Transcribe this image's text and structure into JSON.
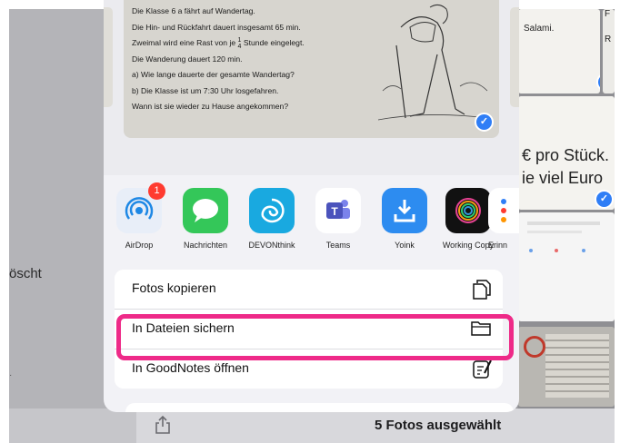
{
  "background": {
    "left_label": "öscht",
    "left_mark": "·",
    "right_texts": [
      "Salami.",
      "€ pro Stück.",
      "ie viel Euro"
    ],
    "right_edge_letters": [
      "F",
      "R"
    ],
    "selected_count": "5 Fotos ausgewählt"
  },
  "preview": {
    "lines": [
      "Die Klasse 6 a fährt auf Wandertag.",
      "Die Hin- und Rückfahrt dauert insgesamt 65 min.",
      "Zweimal wird eine Rast von je",
      "Die Wanderung dauert 120 min.",
      "a) Wie lange dauerte der gesamte Wandertag?",
      "b) Die Klasse ist um 7:30 Uhr losgefahren.",
      "Wann ist sie wieder zu Hause angekommen?"
    ],
    "fraction_num": "1",
    "fraction_den": "4",
    "line3_suffix": "Stunde eingelegt."
  },
  "apps": [
    {
      "label": "AirDrop",
      "icon": "airdrop-icon",
      "badge": "1",
      "color": "#e8eef8"
    },
    {
      "label": "Nachrichten",
      "icon": "messages-icon",
      "color": "#34c759"
    },
    {
      "label": "DEVONthink",
      "icon": "devonthink-icon",
      "color": "#19a9e0"
    },
    {
      "label": "Teams",
      "icon": "teams-icon",
      "color": "#ffffff"
    },
    {
      "label": "Yoink",
      "icon": "yoink-icon",
      "color": "#2d8cf0"
    },
    {
      "label": "Working Copy",
      "icon": "working-copy-icon",
      "color": "#111111"
    },
    {
      "label": "Erinn",
      "icon": "reminders-icon",
      "color": "#ffffff"
    }
  ],
  "actions": [
    {
      "label": "Fotos kopieren",
      "icon": "copy-icon"
    },
    {
      "label": "In Dateien sichern",
      "icon": "folder-icon"
    },
    {
      "label": "In GoodNotes öffnen",
      "icon": "goodnotes-icon"
    }
  ],
  "colors": {
    "highlight": "#ee2a88",
    "accent": "#2f7ef6"
  }
}
